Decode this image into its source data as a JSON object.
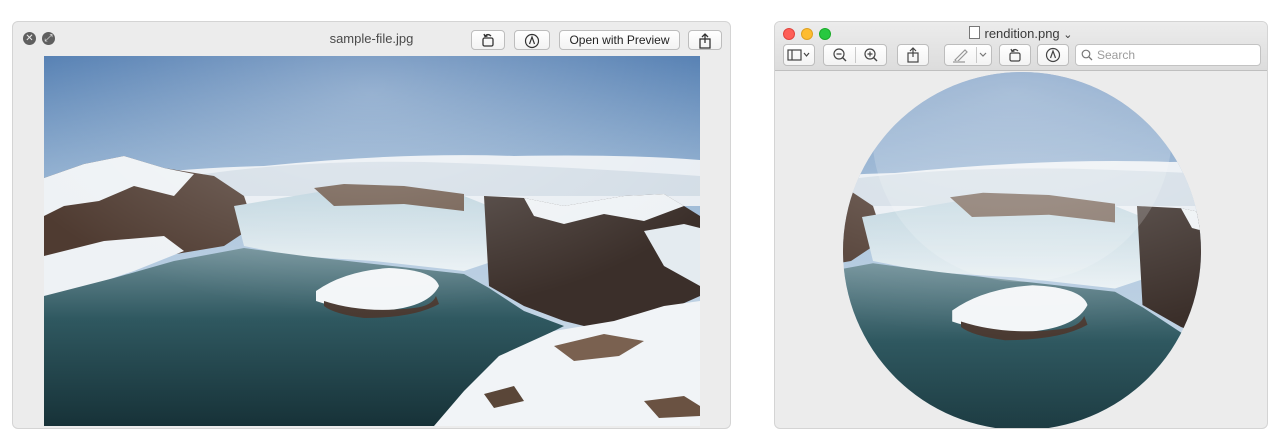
{
  "quicklook": {
    "title": "sample-file.jpg",
    "open_with_label": "Open with Preview",
    "icons": {
      "close": "close-circle-icon",
      "fullscreen": "fullscreen-circle-icon",
      "rotate": "rotate-left-icon",
      "markup": "markup-pen-icon",
      "share": "share-icon"
    }
  },
  "preview": {
    "title": "rendition.png",
    "title_chevron": "⌄",
    "search_placeholder": "Search",
    "traffic_lights": {
      "close": "#fe5f57",
      "minimize": "#febc2e",
      "zoom": "#28c840"
    },
    "icons": {
      "sidebar": "sidebar-view-icon",
      "zoom_out": "zoom-out-icon",
      "zoom_in": "zoom-in-icon",
      "share": "share-icon",
      "highlight": "highlight-pen-icon",
      "rotate": "rotate-left-icon",
      "markup": "markup-pen-icon",
      "search": "search-icon"
    }
  },
  "image_content": "waterfall-snow-landscape"
}
